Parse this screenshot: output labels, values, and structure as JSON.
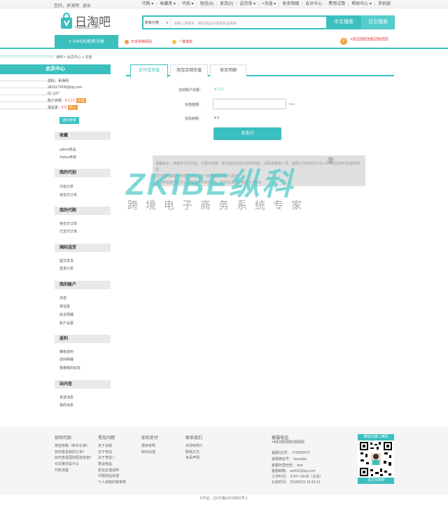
{
  "topbar": {
    "greeting": "您好，吴海明",
    "logout": "退出",
    "links": [
      "代购 ▾",
      "收藏夹 ▾",
      "代拍 ▾",
      "短信(0)",
      "发货(0)",
      "送货单 ▾",
      "+充值 ▾",
      "收支明细",
      "会员中心",
      "费用试算",
      "帮助中心 ▾",
      "手机版"
    ]
  },
  "header": {
    "logo_cn": "日淘吧",
    "logo_en": "ritaoba.com",
    "search_category": "所有分类",
    "search_placeholder": "请输入关键字、微拍商品ID或者商品链接",
    "btn_cn_search": "中文搜索",
    "btn_jp_search": "日文搜索"
  },
  "nav": {
    "main": "YAHOO拍卖分类",
    "item1": "日本购物网站",
    "item2": "一键填单",
    "phone": "+8109039026055"
  },
  "breadcrumb": "海吧 > 会员中心 > 充值",
  "sidebar": {
    "title": "会员中心",
    "hello": "您好，吴海明",
    "email": "2876172636@qq.com",
    "id": "ID: U27",
    "balance_label": "账户余额：",
    "balance_value": "¥ 1.17",
    "recharge": "充值",
    "deposit_label": "保证金：",
    "deposit_value": "¥ 0",
    "deposit_btn": "转入",
    "logout_btn": "退出登录",
    "sections": [
      {
        "title": "收藏",
        "items": [
          "yahoo商品",
          "Yahoo卖家"
        ]
      },
      {
        "title": "我的代拍",
        "items": [
          "代拍订单",
          "待支付订单"
        ]
      },
      {
        "title": "我的代购",
        "items": [
          "待支付订单",
          "已支付订单"
        ]
      },
      {
        "title": "国际送货",
        "items": [
          "提交发货",
          "送货订单"
        ]
      },
      {
        "title": "我的账户",
        "items": [
          "充值",
          "保证金",
          "收支明细",
          "账户设置"
        ]
      },
      {
        "title": "返利",
        "items": [
          "推荐返利",
          "返利明细",
          "我推荐的好友"
        ]
      },
      {
        "title": "站内信",
        "items": [
          "发送消息",
          "我的消息"
        ]
      }
    ]
  },
  "tabs": [
    "支付宝充值",
    "淘宝店铺充值",
    "收支明细"
  ],
  "form": {
    "balance_label": "当前账户余额：",
    "balance_value": "¥ 1.17",
    "amount_label": "充值金额：",
    "unit": "RMB",
    "actual_label": "实际到账：",
    "actual_value": "¥ 0",
    "pay_btn": "去支付"
  },
  "notes": [
    "温馨提示：使用支付宝充值，无需手续费，如充值成功后余额未到账，请联系客服人员，客服工作时间为9:30-18:00(北京时间)说明事项",
    "支付宝的每笔手续费为0元，这个费用需要您自己承担",
    "如使用信用卡支付，单笔最高1000RMB，支付宝收取手续费为 998元"
  ],
  "watermark": {
    "brand": "ZKIBE纵科",
    "reg": "®",
    "sub": "跨境电子商务系统专家"
  },
  "footer": {
    "cols": [
      {
        "title": "如何代拍",
        "items": [
          "竞拍攻略（新手必读）",
          "如何查看我的订单？",
          "如何查看国际配送进度？",
          "日本雅虎是什么",
          "代购流程"
        ]
      },
      {
        "title": "常见问题",
        "items": [
          "关于关税",
          "关于竞拍",
          "关于竞拍二",
          "禁运物品",
          "拆包处理说明",
          "问题商品处理",
          "个人纳税的税率表"
        ]
      },
      {
        "title": "如何支付",
        "items": [
          "费用说明",
          "如何充值"
        ]
      },
      {
        "title": "联系我们",
        "items": [
          "日淘吧简介",
          "联络方式",
          "免责声明"
        ]
      }
    ],
    "service_title": "客服电话",
    "service_phone": "+8109039026055",
    "service_lines": [
      "客服QQ号：  174925073",
      "客服微信号：  liuxueba",
      "客服阿里旺旺：  test",
      "客服邮箱：  wxh31@qq.com",
      "工作时间：  9:30～18:00（北京）",
      "北京时间：  2018/5/22 15:42:12"
    ],
    "qr_top": "微信扫描二维码",
    "qr_bottom": "关注日淘吧",
    "icp": "ICP证：辽ICP备16010862号-1"
  },
  "colors": {
    "accent": "#3bbfbf",
    "red": "#e4393c",
    "orange": "#f29b3a"
  }
}
